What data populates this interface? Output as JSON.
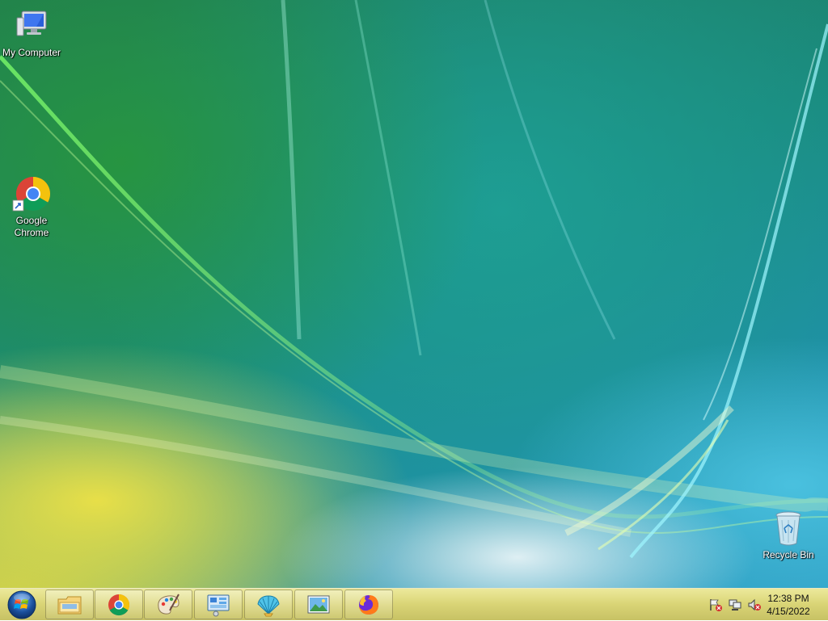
{
  "desktop": {
    "icons": [
      {
        "label": "My Computer",
        "icon": "computer-icon"
      },
      {
        "label": "Google\nChrome",
        "icon": "chrome-icon"
      },
      {
        "label": "Recycle Bin",
        "icon": "recycle-bin-icon"
      }
    ]
  },
  "taskbar": {
    "start": {
      "icon": "windows-logo-icon"
    },
    "pinned": [
      {
        "name": "file-explorer",
        "icon": "folder-icon"
      },
      {
        "name": "google-chrome",
        "icon": "chrome-icon"
      },
      {
        "name": "paint",
        "icon": "paint-palette-icon"
      },
      {
        "name": "control-panel",
        "icon": "control-panel-icon"
      },
      {
        "name": "shell-app",
        "icon": "seashell-icon"
      },
      {
        "name": "photo-viewer",
        "icon": "picture-icon"
      },
      {
        "name": "firefox",
        "icon": "firefox-icon"
      }
    ],
    "tray": {
      "icons": [
        "action-center-flag-icon",
        "network-icon",
        "volume-muted-icon"
      ],
      "time": "12:38 PM",
      "date": "4/15/2022"
    }
  },
  "colors": {
    "taskbar": "#d6d16e",
    "desktop_green": "#1f7a52",
    "desktop_teal": "#1f8fa8",
    "desktop_yellow": "#e2d63c"
  }
}
